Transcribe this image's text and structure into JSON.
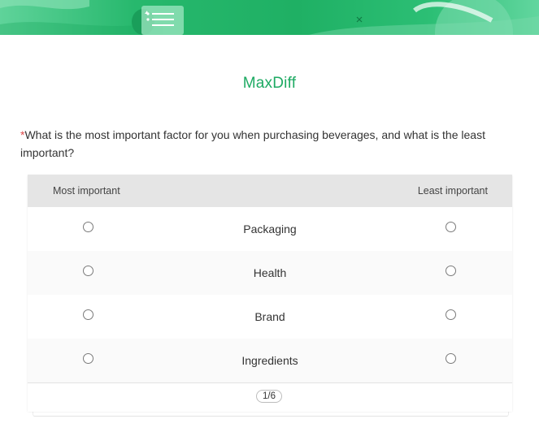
{
  "header": {
    "title": "MaxDiff",
    "accent_color": "#1eaa63",
    "icons": [
      "note-list-icon",
      "planet-icon",
      "sparkle-icon"
    ]
  },
  "question": {
    "required_marker": "*",
    "text": "What is the most important factor for you when purchasing beverages, and what is the least important?"
  },
  "table": {
    "col_most": "Most important",
    "col_least": "Least important",
    "rows": [
      {
        "label": "Packaging"
      },
      {
        "label": "Health"
      },
      {
        "label": "Brand"
      },
      {
        "label": "Ingredients"
      }
    ]
  },
  "pagination": {
    "text": "1/6"
  }
}
